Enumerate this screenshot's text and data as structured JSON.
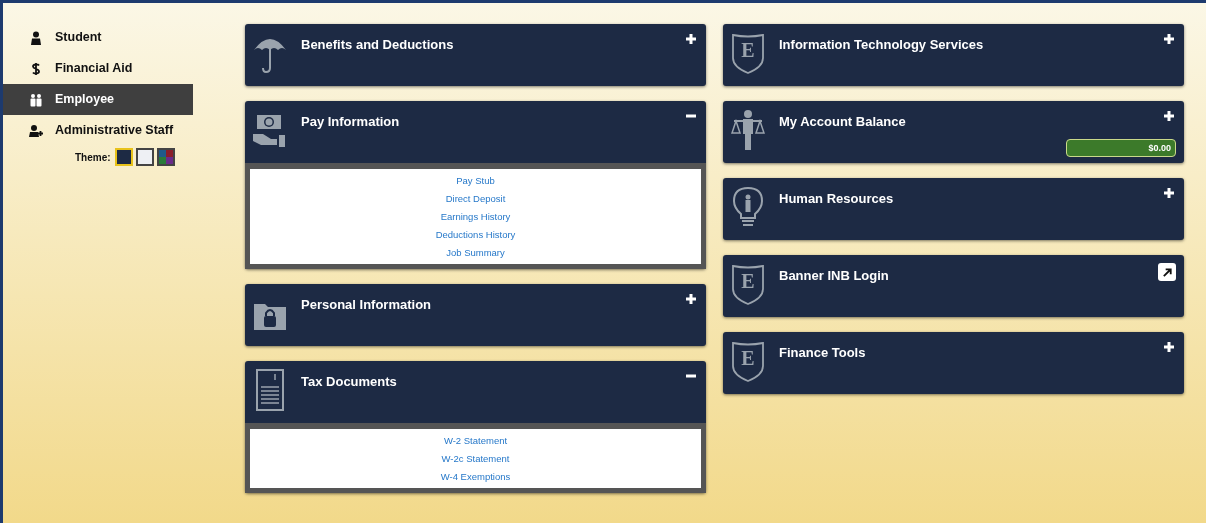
{
  "sidebar": {
    "items": [
      {
        "label": "Student",
        "selected": false
      },
      {
        "label": "Financial Aid",
        "selected": false
      },
      {
        "label": "Employee",
        "selected": true
      },
      {
        "label": "Administrative Staff",
        "selected": false
      }
    ],
    "theme": {
      "label": "Theme:",
      "swatches": [
        {
          "kind": "solid",
          "color": "#1d2a44",
          "selected": true
        },
        {
          "kind": "solid",
          "color": "#eef0f4",
          "selected": false
        },
        {
          "kind": "quad",
          "selected": false
        }
      ]
    }
  },
  "columns": [
    {
      "cards": [
        {
          "title": "Benefits and Deductions",
          "kind": "toggle",
          "expanded": false
        },
        {
          "title": "Pay Information",
          "kind": "toggle",
          "expanded": true,
          "links": [
            "Pay Stub",
            "Direct Deposit",
            "Earnings History",
            "Deductions History",
            "Job Summary"
          ]
        },
        {
          "title": "Personal Information",
          "kind": "toggle",
          "expanded": false
        },
        {
          "title": "Tax Documents",
          "kind": "toggle",
          "expanded": true,
          "links": [
            "W-2 Statement",
            "W-2c Statement",
            "W-4 Exemptions"
          ]
        }
      ]
    },
    {
      "cards": [
        {
          "title": "Information Technology Services",
          "logo_letter": "E",
          "kind": "toggle",
          "expanded": false
        },
        {
          "title": "My Account Balance",
          "kind": "toggle",
          "expanded": false,
          "balance": "$0.00"
        },
        {
          "title": "Human Resources",
          "kind": "toggle",
          "expanded": false
        },
        {
          "title": "Banner INB Login",
          "logo_letter": "E",
          "kind": "external"
        },
        {
          "title": "Finance Tools",
          "logo_letter": "E",
          "kind": "toggle",
          "expanded": false
        }
      ]
    }
  ]
}
